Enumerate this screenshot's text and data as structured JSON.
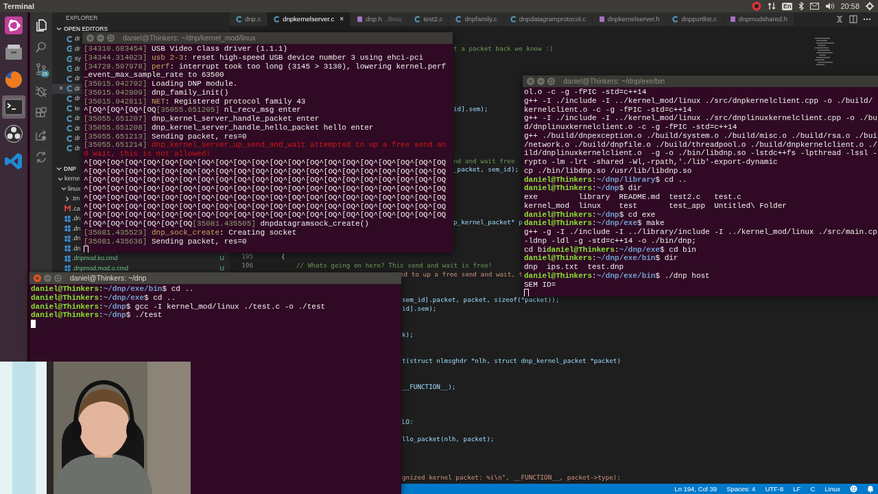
{
  "top_bar": {
    "app_name": "Terminal",
    "keyboard": "En",
    "clock": "20:58"
  },
  "launcher": [
    {
      "kind": "dash",
      "selected": false
    },
    {
      "kind": "files",
      "selected": false
    },
    {
      "kind": "browser",
      "selected": false
    },
    {
      "kind": "terminal",
      "selected": true
    },
    {
      "kind": "recorder",
      "selected": false
    },
    {
      "kind": "code",
      "selected": false
    }
  ],
  "editor": {
    "activity_bar": [
      {
        "kind": "files",
        "selected": true
      },
      {
        "kind": "search",
        "selected": false
      },
      {
        "kind": "source_control",
        "selected": false,
        "badge": "26"
      },
      {
        "kind": "debug",
        "selected": false
      },
      {
        "kind": "extensions",
        "selected": false
      },
      {
        "kind": "share",
        "selected": false
      },
      {
        "kind": "sync",
        "selected": false
      }
    ],
    "sidebar": {
      "title": "EXPLORER",
      "open_editors": {
        "title": "OPEN EDITORS",
        "expanded": true,
        "items": [
          {
            "name": "dr",
            "kind": "c",
            "selected": false
          },
          {
            "name": "dr",
            "kind": "cpp",
            "selected": false
          },
          {
            "name": "sy",
            "kind": "cpp",
            "selected": false
          },
          {
            "name": "dr",
            "kind": "cpp",
            "selected": false
          },
          {
            "name": "dr",
            "kind": "c",
            "selected": false
          },
          {
            "name": "dr",
            "kind": "c",
            "selected": true,
            "close": "×"
          },
          {
            "name": "dr",
            "kind": "c",
            "selected": false
          },
          {
            "name": "te",
            "kind": "c",
            "selected": false
          },
          {
            "name": "dr",
            "kind": "c",
            "selected": false
          },
          {
            "name": "dr",
            "kind": "c",
            "selected": false
          },
          {
            "name": "dr",
            "kind": "c",
            "selected": false
          },
          {
            "name": "dr",
            "kind": "c",
            "selected": false
          }
        ]
      },
      "folder": {
        "title": "DNP",
        "expanded": true,
        "tree": [
          {
            "name": "kerne",
            "kind": "folder",
            "expanded": true,
            "children": [
              {
                "name": "linux",
                "kind": "folder",
                "expanded": true,
                "children": [
                  {
                    "name": ".tm",
                    "kind": "folder",
                    "expanded": false
                  },
                  {
                    "name": ".ca",
                    "kind": "make"
                  },
                  {
                    "name": ".dn",
                    "kind": "cmd"
                  },
                  {
                    "name": ".dn",
                    "kind": "cmd"
                  },
                  {
                    "name": ".dn",
                    "kind": "cmd"
                  },
                  {
                    "name": ".dn",
                    "kind": "cmd"
                  },
                  {
                    "name": ".dnpmod.ko.cmd",
                    "kind": "cmd",
                    "status": "U"
                  },
                  {
                    "name": ".dnpmod.mod.o.cmd",
                    "kind": "cmd",
                    "status": "U"
                  }
                ]
              }
            ]
          }
        ]
      }
    },
    "tabs": [
      {
        "label": "dnp.c",
        "kind": "c",
        "selected": false
      },
      {
        "label": "dnpkernelserver.c",
        "kind": "c",
        "selected": true,
        "close": "×"
      },
      {
        "label": "dnp.h",
        "hint": "../linux",
        "kind": "h",
        "selected": false
      },
      {
        "label": "test2.c",
        "kind": "c",
        "selected": false
      },
      {
        "label": "dnpfamily.c",
        "kind": "c",
        "selected": false
      },
      {
        "label": "dnpdatagramprotocol.c",
        "kind": "c",
        "selected": false
      },
      {
        "label": "dnpkernelserver.h",
        "kind": "h",
        "selected": false
      },
      {
        "label": "dnpportlist.c",
        "kind": "c",
        "selected": false
      },
      {
        "label": "dnpmodshared.h",
        "kind": "h",
        "selected": false
      }
    ],
    "line_numbers": [
      "195",
      "196"
    ],
    "code_fragments": [
      {
        "text": "t a packet back we know :)",
        "kind": "comment"
      },
      {
        "text": "id].sem);",
        "kind": "code"
      },
      {
        "text": "nd and wait free",
        "kind": "comment"
      },
      {
        "text": "_packet, sem_id);",
        "kind": "code"
      },
      {
        "text": "p_kernel_packet* p",
        "kind": "code"
      },
      {
        "text": "{",
        "kind": "plain"
      },
      {
        "text": "// Whats going on here? This send and wait is free!",
        "kind": "comment"
      },
      {
        "text": "ed to up a free send and wait, t",
        "kind": "string"
      },
      {
        "text": "sem_id].packet, packet, sizeof(*packet));",
        "kind": "code"
      },
      {
        "text": "id].sem);",
        "kind": "code"
      },
      {
        "text": "k);",
        "kind": "code"
      },
      {
        "text": "t(struct nlmsghdr *nlh, struct dnp_kernel_packet *packet)",
        "kind": "code"
      },
      {
        "text": "__FUNCTION__);",
        "kind": "code"
      },
      {
        "text": "LO:",
        "kind": "code"
      },
      {
        "text": "llo_packet(nlh, packet);",
        "kind": "code"
      },
      {
        "text": "gnized kernel packet: %i\\n\", __FUNCTION__, packet->type);",
        "kind": "string"
      }
    ],
    "status_bar": [
      "Ln 194, Col 39",
      "Spaces: 4",
      "UTF-8",
      "LF",
      "C",
      "Linux"
    ]
  },
  "terminals": [
    {
      "title": "daniel@Thinkers: ~/dnp/kernel_mod/linux",
      "focused": false,
      "cursor": true,
      "lines": [
        [
          {
            "kind": "time",
            "text": "[34310.683454]"
          },
          {
            "kind": "plain",
            "text": " USB Video Class driver (1.1.1)"
          }
        ],
        [
          {
            "kind": "time",
            "text": "[34344.314023]"
          },
          {
            "kind": "label",
            "text": " usb 2-3"
          },
          {
            "kind": "plain",
            "text": ": reset high-speed USB device number 3 using ehci-pci"
          }
        ],
        [
          {
            "kind": "time",
            "text": "[34729.597978]"
          },
          {
            "kind": "label",
            "text": " perf"
          },
          {
            "kind": "plain",
            "text": ": interrupt took too long (3145 > 3130), lowering kernel.perf"
          }
        ],
        [
          {
            "kind": "plain",
            "text": "_event_max_sample_rate to 63500"
          }
        ],
        [
          {
            "kind": "time",
            "text": "[35015.042792]"
          },
          {
            "kind": "plain",
            "text": " Loading DNP module."
          }
        ],
        [
          {
            "kind": "time",
            "text": "[35015.042809]"
          },
          {
            "kind": "plain",
            "text": " dnp_family_init()"
          }
        ],
        [
          {
            "kind": "time",
            "text": "[35015.042811]"
          },
          {
            "kind": "label",
            "text": " NET"
          },
          {
            "kind": "plain",
            "text": ": Registered protocol family 43"
          }
        ],
        [
          {
            "kind": "plain",
            "text": "^[OQ^[OQ^[OQ^[OQ"
          },
          {
            "kind": "time",
            "text": "[35055.651205]"
          },
          {
            "kind": "plain",
            "text": " nl_recv_msg enter"
          }
        ],
        [
          {
            "kind": "time",
            "text": "[35055.651207]"
          },
          {
            "kind": "plain",
            "text": " dnp_kernel_server_handle_packet enter"
          }
        ],
        [
          {
            "kind": "time",
            "text": "[35055.651208]"
          },
          {
            "kind": "plain",
            "text": " dnp_kernel_server_handle_hello_packet hello enter"
          }
        ],
        [
          {
            "kind": "time",
            "text": "[35055.651213]"
          },
          {
            "kind": "plain",
            "text": " Sending packet, res=0"
          }
        ],
        [
          {
            "kind": "time",
            "text": "[35055.651214]"
          },
          {
            "kind": "error",
            "text": " dnp_kernel_server_up_send_and_wait attempted to up a free send an"
          }
        ],
        [
          {
            "kind": "error",
            "text": "d wait, this is not allowed!"
          }
        ],
        [
          {
            "kind": "plain",
            "text": "^[OQ^[OQ^[OQ^[OQ^[OQ^[OQ^[OQ^[OQ^[OQ^[OQ^[OQ^[OQ^[OQ^[OQ^[OQ^[OQ^[OQ^[OQ^[OQ^[OQ"
          }
        ],
        [
          {
            "kind": "plain",
            "text": "^[OQ^[OQ^[OQ^[OQ^[OQ^[OQ^[OQ^[OQ^[OQ^[OQ^[OQ^[OQ^[OQ^[OQ^[OQ^[OQ^[OQ^[OQ^[OQ^[OQ"
          }
        ],
        [
          {
            "kind": "plain",
            "text": "^[OQ^[OQ^[OQ^[OQ^[OQ^[OQ^[OQ^[OQ^[OQ^[OQ^[OQ^[OQ^[OQ^[OQ^[OQ^[OQ^[OQ^[OQ^[OQ^[OQ"
          }
        ],
        [
          {
            "kind": "plain",
            "text": "^[OQ^[OQ^[OQ^[OQ^[OQ^[OQ^[OQ^[OQ^[OQ^[OQ^[OQ^[OQ^[OQ^[OQ^[OQ^[OQ^[OQ^[OQ^[OQ^[OQ"
          }
        ],
        [
          {
            "kind": "plain",
            "text": "^[OQ^[OQ^[OQ^[OQ^[OQ^[OQ^[OQ^[OQ^[OQ^[OQ^[OQ^[OQ^[OQ^[OQ^[OQ^[OQ^[OQ^[OQ^[OQ^[OQ"
          }
        ],
        [
          {
            "kind": "plain",
            "text": "^[OQ^[OQ^[OQ^[OQ^[OQ^[OQ^[OQ^[OQ^[OQ^[OQ^[OQ^[OQ^[OQ^[OQ^[OQ^[OQ^[OQ^[OQ^[OQ^[OQ"
          }
        ],
        [
          {
            "kind": "plain",
            "text": "^[OQ^[OQ^[OQ^[OQ^[OQ^[OQ^[OQ^[OQ^[OQ^[OQ^[OQ^[OQ^[OQ^[OQ^[OQ^[OQ^[OQ^[OQ^[OQ^[OQ"
          }
        ],
        [
          {
            "kind": "plain",
            "text": "^[OQ^[OQ^[OQ^[OQ^[OQ^[OQ"
          },
          {
            "kind": "time",
            "text": "[35081.435505]"
          },
          {
            "kind": "plain",
            "text": " dnpdatagramsock_create()"
          }
        ],
        [
          {
            "kind": "time",
            "text": "[35081.435523]"
          },
          {
            "kind": "label",
            "text": " dnp_sock_create"
          },
          {
            "kind": "plain",
            "text": ": Creating socket"
          }
        ],
        [
          {
            "kind": "time",
            "text": "[35081.435636]"
          },
          {
            "kind": "plain",
            "text": " Sending packet, res=0"
          }
        ]
      ]
    },
    {
      "title": "daniel@Thinkers: ~/dnp/exe/bin",
      "focused": false,
      "cursor": true,
      "lines": [
        [
          {
            "kind": "plain",
            "text": "ol.o -c -g -fPIC -std=c++14"
          }
        ],
        [
          {
            "kind": "plain",
            "text": "g++ -I ./include -I ../kernel_mod/linux ./src/dnpkernelclient.cpp -o ./build/"
          }
        ],
        [
          {
            "kind": "plain",
            "text": "kernelclient.o -c -g -fPIC -std=c++14"
          }
        ],
        [
          {
            "kind": "plain",
            "text": "g++ -I ./include -I ../kernel_mod/linux ./src/dnplinuxkernelclient.cpp -o ./bu"
          }
        ],
        [
          {
            "kind": "plain",
            "text": "d/dnplinuxkernelclient.o -c -g -fPIC -std=c++14"
          }
        ],
        [
          {
            "kind": "plain",
            "text": "g++ ./build/dnpexception.o ./build/system.o ./build/misc.o ./build/rsa.o ./bui"
          }
        ],
        [
          {
            "kind": "plain",
            "text": "/network.o ./build/dnpfile.o ./build/threadpool.o ./build/dnpkernelclient.o ./"
          }
        ],
        [
          {
            "kind": "plain",
            "text": "ild/dnplinuxkernelclient.o  -g -o ./bin/libdnp.so -lstdc++fs -lpthread -lssl -"
          }
        ],
        [
          {
            "kind": "plain",
            "text": "rypto -lm -lrt -shared -Wl,-rpath,'./lib'-export-dynamic"
          }
        ],
        [
          {
            "kind": "plain",
            "text": "cp ./bin/libdnp.so /usr/lib/libdnp.so"
          }
        ],
        [
          {
            "kind": "user",
            "text": "daniel@Thinkers"
          },
          {
            "kind": "plain",
            "text": ":"
          },
          {
            "kind": "path",
            "text": "~/dnp/library"
          },
          {
            "kind": "plain",
            "text": "$ cd .."
          }
        ],
        [
          {
            "kind": "user",
            "text": "daniel@Thinkers"
          },
          {
            "kind": "plain",
            "text": ":"
          },
          {
            "kind": "path",
            "text": "~/dnp"
          },
          {
            "kind": "plain",
            "text": "$ dir"
          }
        ],
        [
          {
            "kind": "plain",
            "text": "exe         library  README.md  test2.c   test.c"
          }
        ],
        [
          {
            "kind": "plain",
            "text": "kernel_mod  linux    test       test_app  Untitled\\ Folder"
          }
        ],
        [
          {
            "kind": "user",
            "text": "daniel@Thinkers"
          },
          {
            "kind": "plain",
            "text": ":"
          },
          {
            "kind": "path",
            "text": "~/dnp"
          },
          {
            "kind": "plain",
            "text": "$ cd exe"
          }
        ],
        [
          {
            "kind": "user",
            "text": "daniel@Thinkers"
          },
          {
            "kind": "plain",
            "text": ":"
          },
          {
            "kind": "path",
            "text": "~/dnp/exe"
          },
          {
            "kind": "plain",
            "text": "$ make"
          }
        ],
        [
          {
            "kind": "plain",
            "text": "g++ -g -I ./include -I ../library/include -I ../kernel_mod/linux ./src/main.cp"
          }
        ],
        [
          {
            "kind": "plain",
            "text": "-ldnp -ldl -g -std=c++14 -o ./bin/dnp;"
          }
        ],
        [
          {
            "kind": "plain",
            "text": "cd bi"
          },
          {
            "kind": "user",
            "text": "daniel@Thinkers"
          },
          {
            "kind": "plain",
            "text": ":"
          },
          {
            "kind": "path",
            "text": "~/dnp/exe"
          },
          {
            "kind": "plain",
            "text": "$ cd bin"
          }
        ],
        [
          {
            "kind": "user",
            "text": "daniel@Thinkers"
          },
          {
            "kind": "plain",
            "text": ":"
          },
          {
            "kind": "path",
            "text": "~/dnp/exe/bin"
          },
          {
            "kind": "plain",
            "text": "$ dir"
          }
        ],
        [
          {
            "kind": "plain",
            "text": "dnp  ips.txt  test.dnp"
          }
        ],
        [
          {
            "kind": "user",
            "text": "daniel@Thinkers"
          },
          {
            "kind": "plain",
            "text": ":"
          },
          {
            "kind": "path",
            "text": "~/dnp/exe/bin"
          },
          {
            "kind": "plain",
            "text": "$ ./dnp host"
          }
        ],
        [
          {
            "kind": "plain",
            "text": "SEM ID="
          }
        ]
      ]
    },
    {
      "title": "daniel@Thinkers: ~/dnp",
      "focused": true,
      "cursor": true,
      "lines": [
        [
          {
            "kind": "user",
            "text": "daniel@Thinkers"
          },
          {
            "kind": "plain",
            "text": ":"
          },
          {
            "kind": "path",
            "text": "~/dnp/exe/bin"
          },
          {
            "kind": "plain",
            "text": "$ cd .."
          }
        ],
        [
          {
            "kind": "user",
            "text": "daniel@Thinkers"
          },
          {
            "kind": "plain",
            "text": ":"
          },
          {
            "kind": "path",
            "text": "~/dnp/exe"
          },
          {
            "kind": "plain",
            "text": "$ cd .."
          }
        ],
        [
          {
            "kind": "user",
            "text": "daniel@Thinkers"
          },
          {
            "kind": "plain",
            "text": ":"
          },
          {
            "kind": "path",
            "text": "~/dnp"
          },
          {
            "kind": "plain",
            "text": "$ gcc -I kernel_mod/linux ./test.c -o ./test"
          }
        ],
        [
          {
            "kind": "user",
            "text": "daniel@Thinkers"
          },
          {
            "kind": "plain",
            "text": ":"
          },
          {
            "kind": "path",
            "text": "~/dnp"
          },
          {
            "kind": "plain",
            "text": "$ ./test"
          }
        ]
      ]
    }
  ]
}
